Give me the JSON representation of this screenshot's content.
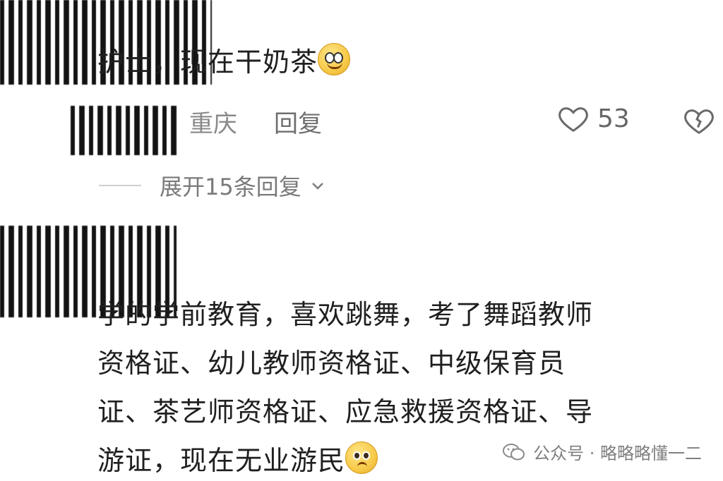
{
  "comment1": {
    "text": "护士，现在干奶茶",
    "emoji": "smiling-face-icon",
    "location": "重庆",
    "reply_label": "回复",
    "like_count": "53"
  },
  "expand": {
    "label": "展开15条回复"
  },
  "comment2": {
    "lines": [
      "学的学前教育，喜欢跳舞，考了舞蹈教师",
      "资格证、幼儿教师资格证、中级保育员",
      "证、茶艺师资格证、应急救援资格证、导",
      "游证，现在无业游民"
    ],
    "emoji": "pleading-face-icon"
  },
  "watermark": {
    "text": "公众号 · 略略略懂一二",
    "icon": "wechat-icon"
  },
  "colors": {
    "text": "#1f1f1f",
    "meta": "#8a8a8a",
    "background": "#ffffff"
  }
}
